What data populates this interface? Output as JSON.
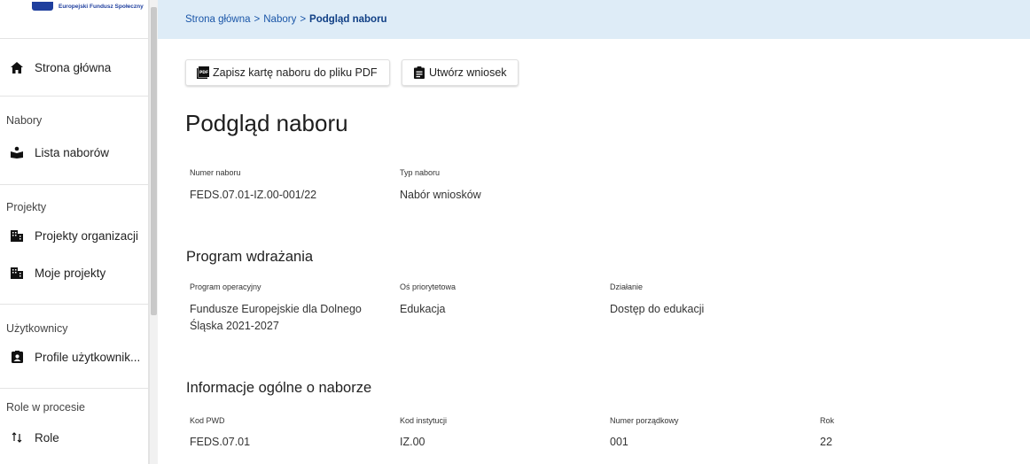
{
  "logo": {
    "text": "Europejski Fundusz Społeczny"
  },
  "sidebar": {
    "home": "Strona główna",
    "sections": [
      {
        "header": "Nabory",
        "items": [
          {
            "label": "Lista naborów",
            "icon": "reader-icon"
          }
        ]
      },
      {
        "header": "Projekty",
        "items": [
          {
            "label": "Projekty organizacji",
            "icon": "building-icon"
          },
          {
            "label": "Moje projekty",
            "icon": "building-icon"
          }
        ]
      },
      {
        "header": "Użytkownicy",
        "items": [
          {
            "label": "Profile użytkownik...",
            "icon": "contact-card-icon"
          }
        ]
      },
      {
        "header": "Role w procesie",
        "items": [
          {
            "label": "Role",
            "icon": "swap-arrows-icon"
          }
        ]
      }
    ]
  },
  "breadcrumb": {
    "home": "Strona główna",
    "sep": ">",
    "level2": "Nabory",
    "current": "Podgląd naboru"
  },
  "toolbar": {
    "pdf_label": "Zapisz kartę naboru do pliku PDF",
    "create_label": "Utwórz wniosek"
  },
  "page": {
    "title": "Podgląd naboru"
  },
  "details": {
    "numer_label": "Numer naboru",
    "numer_value": "FEDS.07.01-IZ.00-001/22",
    "typ_label": "Typ naboru",
    "typ_value": "Nabór wniosków"
  },
  "program": {
    "title": "Program wdrażania",
    "po_label": "Program operacyjny",
    "po_value_line1": "Fundusze Europejskie dla Dolnego",
    "po_value_line2": "Śląska 2021-2027",
    "os_label": "Oś priorytetowa",
    "os_value": "Edukacja",
    "dz_label": "Działanie",
    "dz_value": "Dostęp do edukacji"
  },
  "info": {
    "title": "Informacje ogólne o naborze",
    "pwd_label": "Kod PWD",
    "pwd_value": "FEDS.07.01",
    "inst_label": "Kod instytucji",
    "inst_value": "IZ.00",
    "nr_label": "Numer porządkowy",
    "nr_value": "001",
    "rok_label": "Rok",
    "rok_value": "22"
  },
  "colors": {
    "accent": "#1a56a8",
    "breadcrumb_bg": "#deecf7",
    "logo_blue": "#1f3f9e"
  }
}
